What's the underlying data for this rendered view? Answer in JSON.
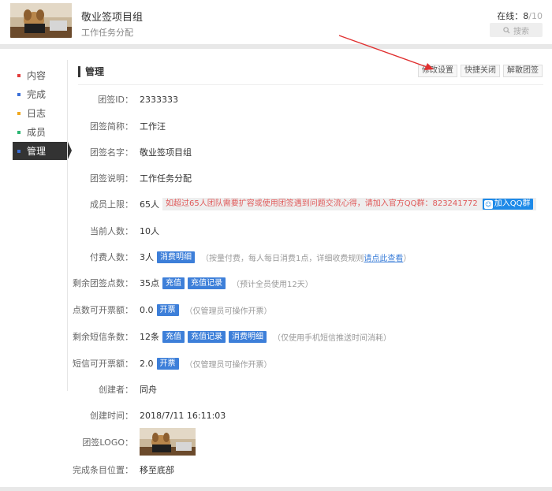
{
  "header": {
    "group_name": "敬业签项目组",
    "group_desc": "工作任务分配",
    "online_label": "在线：",
    "online_count": "8",
    "online_max": "/10",
    "search_placeholder": "搜索"
  },
  "sidebar": {
    "items": [
      {
        "label": "内容",
        "color": "#e23b3b"
      },
      {
        "label": "完成",
        "color": "#3a6fd8"
      },
      {
        "label": "日志",
        "color": "#f0a820"
      },
      {
        "label": "成员",
        "color": "#2bb673"
      },
      {
        "label": "管理",
        "color": "#3a6fd8"
      }
    ]
  },
  "main": {
    "title": "管理",
    "buttons": {
      "edit": "修改设置",
      "shortcut_close": "快捷关闭",
      "dissolve": "解散团签"
    }
  },
  "fields": {
    "id": {
      "label": "团签ID：",
      "value": "2333333"
    },
    "short_name": {
      "label": "团签简称：",
      "value": "工作汪"
    },
    "name": {
      "label": "团签名字：",
      "value": "敬业签项目组"
    },
    "desc": {
      "label": "团签说明：",
      "value": "工作任务分配"
    },
    "member_limit": {
      "label": "成员上限：",
      "value": "65人",
      "warning": "如超过65人团队需要扩容或使用团签遇到问题交流心得，请加入官方QQ群：823241772",
      "qq_button": "加入QQ群"
    },
    "current_members": {
      "label": "当前人数：",
      "value": "10人"
    },
    "paid_members": {
      "label": "付费人数：",
      "value": "3人",
      "btn": "消费明细",
      "hint": "（按量付费，每人每日消费1点，详细收费规则",
      "hint_link": "请点此查看",
      "hint_end": "）"
    },
    "points": {
      "label": "剩余团签点数：",
      "value": "35点",
      "btn1": "充值",
      "btn2": "充值记录",
      "hint": "（预计全员使用12天）"
    },
    "invoice_points": {
      "label": "点数可开票额：",
      "value": "0.0",
      "btn": "开票",
      "hint": "（仅管理员可操作开票）"
    },
    "sms": {
      "label": "剩余短信条数：",
      "value": "12条",
      "btn1": "充值",
      "btn2": "充值记录",
      "btn3": "消费明细",
      "hint": "（仅使用手机短信推送时间消耗）"
    },
    "invoice_sms": {
      "label": "短信可开票额：",
      "value": "2.0",
      "btn": "开票",
      "hint": "（仅管理员可操作开票）"
    },
    "creator": {
      "label": "创建者：",
      "value": "同舟"
    },
    "created_at": {
      "label": "创建时间：",
      "value": "2018/7/11 16:11:03"
    },
    "logo": {
      "label": "团签LOGO："
    },
    "done_position": {
      "label": "完成条目位置：",
      "value": "移至底部"
    }
  }
}
